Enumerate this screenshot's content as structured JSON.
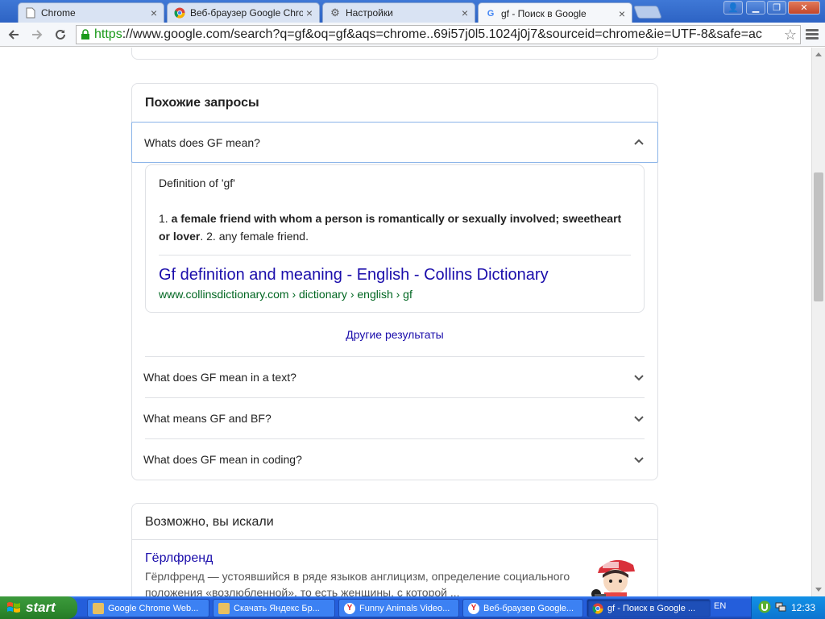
{
  "tabs": [
    {
      "label": "Chrome",
      "icon": "document-icon"
    },
    {
      "label": "Веб-браузер Google Chrome",
      "icon": "chrome-icon"
    },
    {
      "label": "Настройки",
      "icon": "gear-icon"
    },
    {
      "label": "gf - Поиск в Google",
      "icon": "google-g-icon"
    }
  ],
  "toolbar": {
    "url_scheme": "https",
    "url_rest": "://www.google.com/search?q=gf&oq=gf&aqs=chrome..69i57j0l5.1024j0j7&sourceid=chrome&ie=UTF-8&safe=ac"
  },
  "related": {
    "heading": "Похожие запросы",
    "open_question": "Whats does GF mean?",
    "answer": {
      "label": "Definition of 'gf'",
      "num1": "1. ",
      "bold": "a female friend with whom a person is romantically or sexually involved; sweetheart or lover",
      "rest": ". 2. any female friend.",
      "link_title": "Gf definition and meaning - English - Collins Dictionary",
      "cite": "www.collinsdictionary.com › dictionary › english › gf"
    },
    "more_label": "Другие результаты",
    "questions": [
      "What does GF mean in a text?",
      "What means GF and BF?",
      "What does GF mean in coding?"
    ]
  },
  "maybe": {
    "heading": "Возможно, вы искали",
    "result_title": "Гёрлфренд",
    "result_snippet": "Гёрлфренд — устоявшийся в ряде языков англицизм, определение социального положения «возлюбленной», то есть женщины, с которой ..."
  },
  "taskbar": {
    "start_label": "start",
    "buttons": [
      {
        "label": "Google Chrome Web...",
        "icon": "app-icon"
      },
      {
        "label": "Скачать Яндекс Бр...",
        "icon": "app-icon"
      },
      {
        "label": "Funny Animals Video...",
        "icon": "yandex-icon"
      },
      {
        "label": "Веб-браузер Google...",
        "icon": "yandex-icon"
      },
      {
        "label": "gf - Поиск в Google ...",
        "icon": "chrome-icon"
      }
    ],
    "language": "EN",
    "clock": "12:33"
  }
}
